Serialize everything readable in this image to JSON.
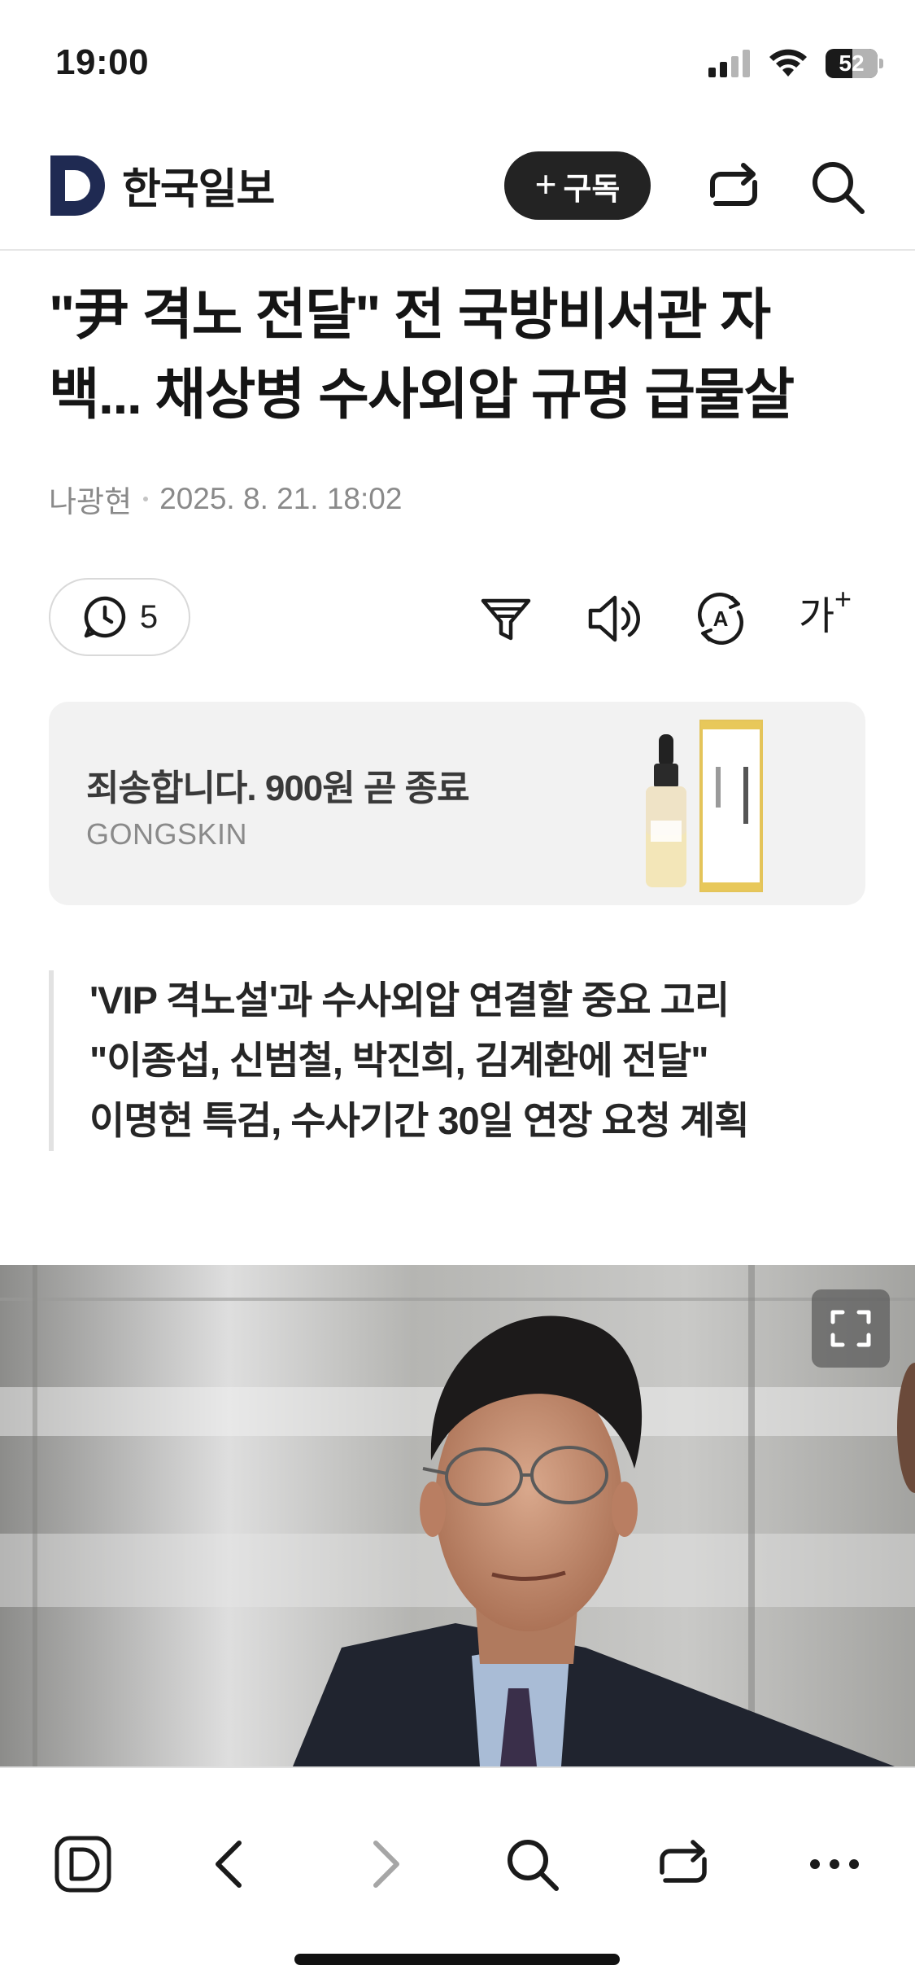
{
  "status_bar": {
    "time": "19:00",
    "battery": "52"
  },
  "header": {
    "logo_text": "한국일보",
    "subscribe_label": "구독"
  },
  "article": {
    "headline_line1": "\"尹 격노 전달\" 전 국방비서관 자",
    "headline_line2": "백... 채상병 수사외압 규명 급물살",
    "author": "나광현",
    "datetime": "2025. 8. 21. 18:02",
    "comment_count": "5",
    "font_size_label": "가"
  },
  "ad": {
    "title": "죄송합니다. 900원 곧 종료",
    "brand": "GONGSKIN"
  },
  "summary": [
    "'VIP 격노설'과 수사외압 연결할 중요 고리",
    "\"이종섭, 신범철, 박진희, 김계환에 전달\"",
    "이명현 특검, 수사기간 30일 연장 요청 계획"
  ],
  "colors": {
    "logo_navy": "#1f2a52",
    "subscribe_bg": "#232323",
    "ad_bg": "#f2f2f2"
  },
  "icons": {
    "header": [
      "share-icon",
      "search-icon"
    ],
    "toolbar": [
      "comment-clock-icon",
      "filter-icon",
      "speaker-icon",
      "translate-icon",
      "font-size-icon"
    ],
    "bottom": [
      "home-logo-icon",
      "back-icon",
      "forward-icon",
      "search-icon",
      "share-icon",
      "more-icon"
    ]
  }
}
